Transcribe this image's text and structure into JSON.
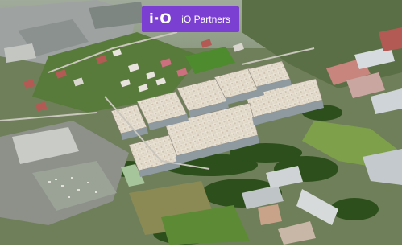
{
  "overlay": {
    "logo_text": "i·O",
    "brand_name": "iO Partners",
    "badge_color": "#7b3fd2"
  },
  "photo": {
    "subject": "aerial-rendering-industrial-park"
  },
  "colors": {
    "roof": "#e7dfd2",
    "grass": "#4f7a2c",
    "trees": "#2d4f1c",
    "residential_roof": "#b45a55"
  }
}
